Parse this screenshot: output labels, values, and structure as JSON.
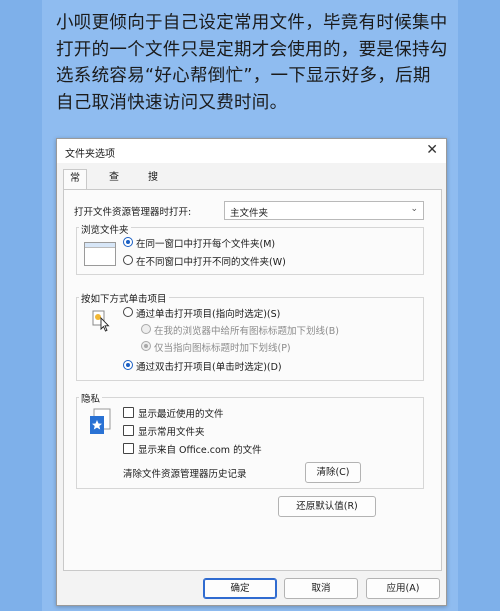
{
  "intro_text": "小呗更倾向于自己设定常用文件，毕竟有时候集中打开的一个文件只是定期才会使用的，要是保持勾选系统容易“好心帮倒忙”，一下显示好多，后期自己取消快速访问又费时间。",
  "dialog": {
    "title": "文件夹选项",
    "close_glyph": "✕",
    "tabs": [
      "常规",
      "查看",
      "搜索"
    ],
    "open_explorer_label": "打开文件资源管理器时打开:",
    "open_explorer_value": "主文件夹",
    "browse": {
      "title": "浏览文件夹",
      "opt_same": "在同一窗口中打开每个文件夹(M)",
      "opt_new": "在不同窗口中打开不同的文件夹(W)"
    },
    "click": {
      "title": "按如下方式单击项目",
      "opt_single": "通过单击打开项目(指向时选定)(S)",
      "sub_browser": "在我的浏览器中给所有图标标题加下划线(B)",
      "sub_hover": "仅当指向图标标题时加下划线(P)",
      "opt_double": "通过双击打开项目(单击时选定)(D)"
    },
    "privacy": {
      "title": "隐私",
      "show_recent": "显示最近使用的文件",
      "show_frequent": "显示常用文件夹",
      "show_office": "显示来自 Office.com 的文件",
      "clear_history_label": "清除文件资源管理器历史记录",
      "clear_button": "清除(C)"
    },
    "restore_defaults": "还原默认值(R)",
    "ok": "确定",
    "cancel": "取消",
    "apply": "应用(A)"
  }
}
